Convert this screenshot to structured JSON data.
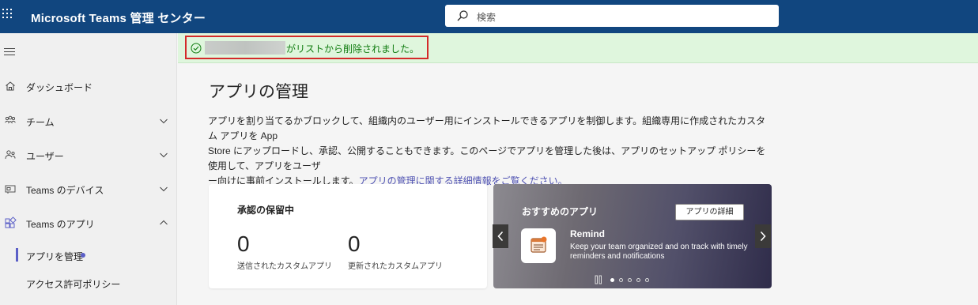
{
  "app": {
    "title": "Microsoft Teams 管理 センター"
  },
  "search": {
    "placeholder": "検索"
  },
  "sidebar": {
    "items": [
      {
        "label": "ダッシュボード",
        "icon": "home-icon"
      },
      {
        "label": "チーム",
        "icon": "teams-icon",
        "expanded": false
      },
      {
        "label": "ユーザー",
        "icon": "users-icon",
        "expanded": false
      },
      {
        "label": "Teams のデバイス",
        "icon": "devices-icon",
        "expanded": false
      },
      {
        "label": "Teams のアプリ",
        "icon": "apps-icon",
        "expanded": true
      }
    ],
    "subitems": [
      {
        "label": "アプリを管理",
        "active": true
      },
      {
        "label": "アクセス許可ポリシー",
        "active": false
      }
    ]
  },
  "banner": {
    "message": "がリストから削除されました。"
  },
  "page": {
    "title": "アプリの管理",
    "description_line1": "アプリを割り当てるかブロックして、組織内のユーザー用にインストールできるアプリを制御します。組織専用に作成されたカスタム アプリを App",
    "description_line2": "Store にアップロードし、承認、公開することもできます。このページでアプリを管理した後は、アプリのセットアップ ポリシーを使用して、アプリをユーザ",
    "description_line3": "ー向けに事前インストールします。",
    "description_link": "アプリの管理に関する詳細情報をご覧ください。"
  },
  "pending": {
    "title": "承認の保留中",
    "submitted_count": "0",
    "submitted_label": "送信されたカスタムアプリ",
    "updated_count": "0",
    "updated_label": "更新されたカスタムアプリ"
  },
  "featured": {
    "title": "おすすめのアプリ",
    "details_button": "アプリの詳細",
    "app_name": "Remind",
    "app_description": "Keep your team organized and on track with timely reminders and notifications",
    "slide_count": 5,
    "active_slide": 1
  },
  "colors": {
    "header": "#11467f",
    "accent": "#5b5fc7",
    "success_bg": "#dff6dd",
    "success_text": "#107c10",
    "highlight_border": "#d42a2a"
  }
}
